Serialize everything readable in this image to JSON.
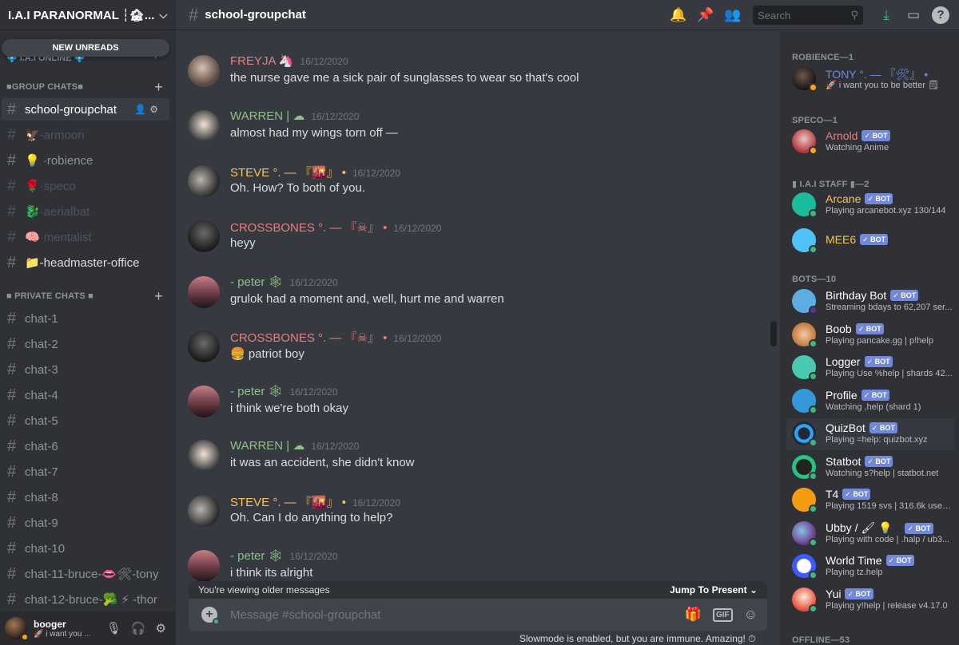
{
  "server": {
    "name": "I.A.I PARANORMAL ┆🏚..."
  },
  "sidebar": {
    "new_unreads": "NEW UNREADS",
    "online_category": "💠 I.A.I ONLINE 💠",
    "group_category": "■GROUP CHATS■",
    "private_category": "■ PRIVATE CHATS ■",
    "group_channels": [
      {
        "name": "school-groupchat"
      },
      {
        "name": "🦅-armoon"
      },
      {
        "name": "💡 ·robience"
      },
      {
        "name": "🌹·speco"
      },
      {
        "name": "🐉·aerialbat"
      },
      {
        "name": "🧠·mentalist"
      },
      {
        "name": "📁-headmaster-office"
      }
    ],
    "private_channels": [
      {
        "name": "chat-1"
      },
      {
        "name": "chat-2"
      },
      {
        "name": "chat-3"
      },
      {
        "name": "chat-4"
      },
      {
        "name": "chat-5"
      },
      {
        "name": "chat-6"
      },
      {
        "name": "chat-7"
      },
      {
        "name": "chat-8"
      },
      {
        "name": "chat-9"
      },
      {
        "name": "chat-10"
      },
      {
        "name": "chat-11-bruce-👄🛠-tony"
      },
      {
        "name": "chat-12-bruce-🥦 ⚡ -thor"
      }
    ]
  },
  "user": {
    "name": "booger",
    "status": "🚀 i want you ..."
  },
  "topbar": {
    "channel": "school-groupchat",
    "search_placeholder": "Search"
  },
  "messages": [
    {
      "author": "FREYJA 🦄",
      "color": "#e67f7f",
      "time": "16/12/2020",
      "text": "the nurse gave me a sick pair of sunglasses to wear so that's cool",
      "avatar": "freyja"
    },
    {
      "author": "WARREN | ☁",
      "color": "#8fc089",
      "time": "16/12/2020",
      "text": "almost had my wings torn off —",
      "avatar": "warren"
    },
    {
      "author": "STEVE °. — 『🌇』 •",
      "color": "#f3c45f",
      "time": "16/12/2020",
      "text": "Oh. How? To both of you.",
      "avatar": "steve"
    },
    {
      "author": "CROSSBONES °. — 『☠』 •",
      "color": "#e67f7f",
      "time": "16/12/2020",
      "text": "heyy",
      "avatar": "cross"
    },
    {
      "author": "- peter 🕸",
      "color": "#8fc089",
      "time": "16/12/2020",
      "text": "grulok had a moment and, well, hurt me and warren",
      "avatar": "peter"
    },
    {
      "author": "CROSSBONES °. — 『☠』 •",
      "color": "#e67f7f",
      "time": "16/12/2020",
      "text": "🍔 patriot boy",
      "avatar": "cross"
    },
    {
      "author": "- peter 🕸",
      "color": "#8fc089",
      "time": "16/12/2020",
      "text": "i think we're both okay",
      "avatar": "peter"
    },
    {
      "author": "WARREN | ☁",
      "color": "#8fc089",
      "time": "16/12/2020",
      "text": "it was an accident, she didn't know",
      "avatar": "warren"
    },
    {
      "author": "STEVE °. — 『🌇』 •",
      "color": "#f3c45f",
      "time": "16/12/2020",
      "text": "Oh. Can I do anything to help?",
      "avatar": "steve"
    },
    {
      "author": "- peter 🕸",
      "color": "#8fc089",
      "time": "16/12/2020",
      "text": "i think its alright",
      "avatar": "peter"
    }
  ],
  "composer": {
    "older_notice": "You're viewing older messages",
    "jump": "Jump To Present",
    "placeholder": "Message #school-groupchat",
    "gif": "GIF",
    "slowmode": "Slowmode is enabled, but you are immune. Amazing! ⏱"
  },
  "members": {
    "roles": [
      {
        "title": "ROBIENCE—1"
      },
      {
        "title": "SPECO—1"
      },
      {
        "title": "▮ I.A.I STAFF ▮—2"
      },
      {
        "title": "BOTS—10"
      },
      {
        "title": "OFFLINE—53"
      }
    ],
    "bot_badge": "✓ BOT",
    "list": [
      {
        "name": "TONY °. — 『🛠』 •",
        "sub": "🚀 i want you to be better 🗒",
        "color": "#7289da",
        "bot": false,
        "status": "idle"
      },
      {
        "name": "Arnold",
        "sub": "Watching Anime",
        "color": "#e67f7f",
        "bot": true,
        "status": "idle"
      },
      {
        "name": "Arcane",
        "sub": "Playing arcanebot.xyz 130/144",
        "color": "#f3c45f",
        "bot": true,
        "status": "online"
      },
      {
        "name": "MEE6",
        "sub": "",
        "color": "#f3c45f",
        "bot": true,
        "status": "online"
      },
      {
        "name": "Birthday Bot",
        "sub": "Streaming bdays to 62,207 ser...",
        "color": "#ffffff",
        "bot": true,
        "status": "stream"
      },
      {
        "name": "Boob",
        "sub": "Playing pancake.gg | p!help",
        "color": "#ffffff",
        "bot": true,
        "status": "online"
      },
      {
        "name": "Logger",
        "sub": "Playing Use %help | shards 42...",
        "color": "#ffffff",
        "bot": true,
        "status": "online"
      },
      {
        "name": "Profile",
        "sub": "Watching ,help (shard 1)",
        "color": "#ffffff",
        "bot": true,
        "status": "online"
      },
      {
        "name": "QuizBot",
        "sub": "Playing =help: quizbot.xyz",
        "color": "#ffffff",
        "bot": true,
        "status": "online"
      },
      {
        "name": "Statbot",
        "sub": "Watching s?help | statbot.net",
        "color": "#ffffff",
        "bot": true,
        "status": "online"
      },
      {
        "name": "T4",
        "sub": "Playing 1519 svs | 316.6k users...",
        "color": "#ffffff",
        "bot": true,
        "status": "online"
      },
      {
        "name": "Ubby / 🖌 💡",
        "sub": "Playing with code | .halp / ub3...",
        "color": "#ffffff",
        "bot": true,
        "status": "online"
      },
      {
        "name": "World Time",
        "sub": "Playing tz.help",
        "color": "#ffffff",
        "bot": true,
        "status": "online"
      },
      {
        "name": "Yui",
        "sub": "Playing y!help | release v4.17.0",
        "color": "#ffffff",
        "bot": true,
        "status": "online"
      }
    ]
  }
}
